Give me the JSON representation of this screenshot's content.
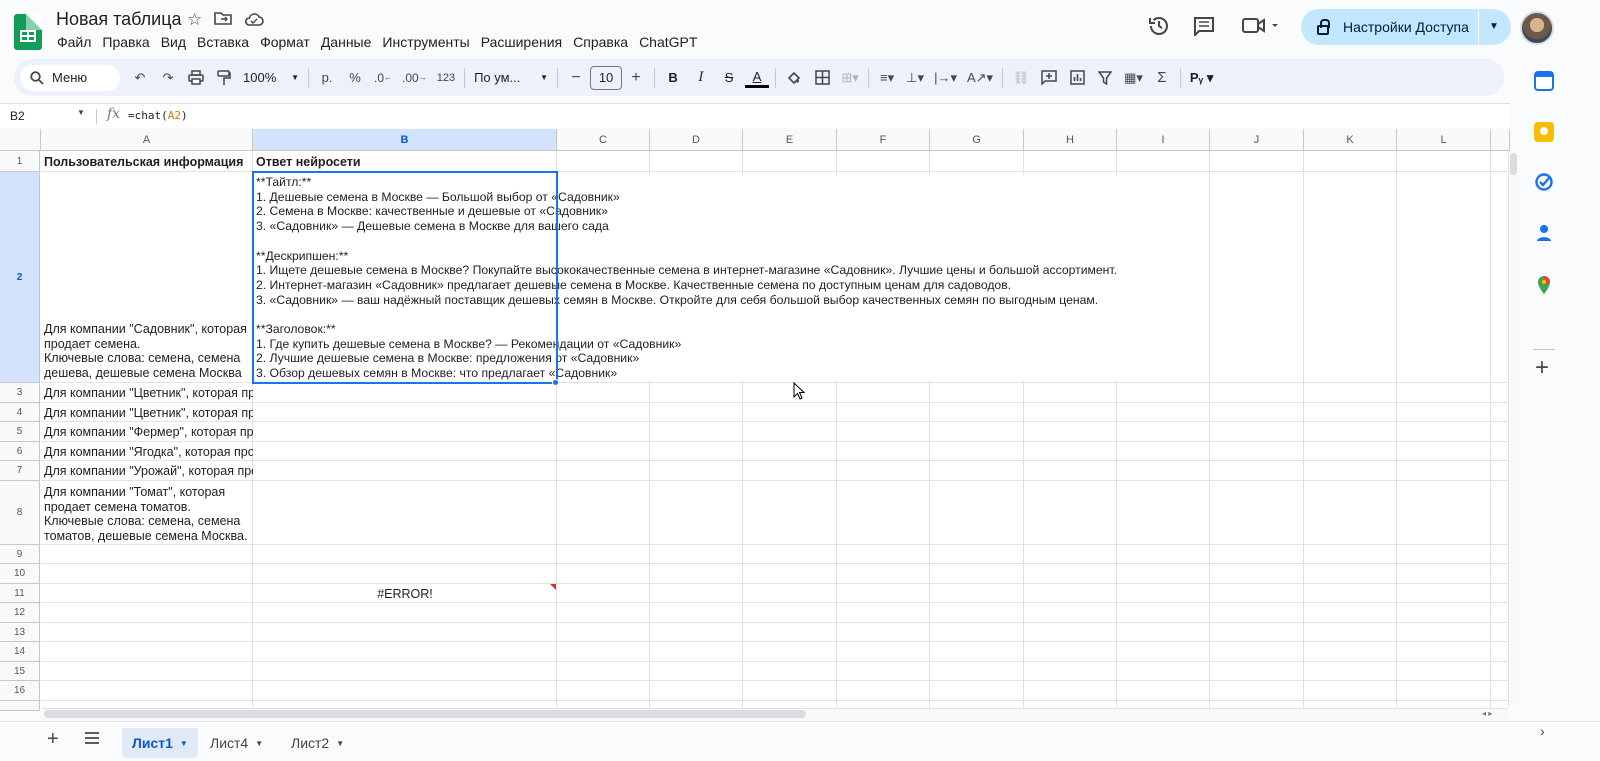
{
  "doc": {
    "title": "Новая таблица"
  },
  "menu": [
    "Файл",
    "Правка",
    "Вид",
    "Вставка",
    "Формат",
    "Данные",
    "Инструменты",
    "Расширения",
    "Справка",
    "ChatGPT"
  ],
  "share": {
    "label": "Настройки Доступа"
  },
  "toolbar": {
    "menu_label": "Меню",
    "zoom": "100%",
    "currency": "р.",
    "percent": "%",
    "dec_less": ".0",
    "dec_more": ".00",
    "number_format": "123",
    "font": "По ум...",
    "font_size": "10"
  },
  "formula_bar": {
    "cell_ref": "B2",
    "formula_prefix": "=chat(",
    "formula_ref": "A2",
    "formula_suffix": ")"
  },
  "columns": [
    "A",
    "B",
    "C",
    "D",
    "E",
    "F",
    "G",
    "H",
    "I",
    "J",
    "K",
    "L"
  ],
  "rows": [
    "1",
    "2",
    "3",
    "4",
    "5",
    "6",
    "7",
    "8",
    "9",
    "10",
    "11",
    "12",
    "13",
    "14",
    "15",
    "16"
  ],
  "cells": {
    "A1": "Пользовательская информация",
    "B1": "Ответ нейросети",
    "A2": [
      "Для компании \"Садовник\", которая",
      "продает семена.",
      "Ключевые слова: семена, семена",
      "дешева, дешевые семена Москва"
    ],
    "B2": [
      "**Тайтл:**",
      "1. Дешевые семена в Москве — Большой выбор от «Садовник»",
      "2. Семена в Москве: качественные и дешевые от «Садовник»",
      "3. «Садовник» — Дешевые семена в Москве для вашего сада",
      "",
      "**Дескрипшен:**",
      "1. Ищете дешевые семена в Москве? Покупайте высококачественные семена в интернет-магазине «Садовник». Лучшие цены и большой ассортимент.",
      "2. Интернет-магазин «Садовник» предлагает дешевые семена в Москве. Качественные семена по доступным ценам для садоводов.",
      "3. «Садовник» — ваш надёжный поставщик дешевых семян в Москве. Откройте для себя большой выбор качественных семян по выгодным ценам.",
      "",
      "**Заголовок:**",
      "1. Где купить дешевые семена в Москве? — Рекомендации от «Садовник»",
      "2. Лучшие дешевые семена в Москве: предложения от «Садовник»",
      "3. Обзор дешевых семян в Москве: что предлагает «Садовник»"
    ],
    "A3": "Для компании \"Цветник\", которая про",
    "A4": "Для компании \"Цветник\", которая про",
    "A5": "Для компании \"Фермер\", которая про",
    "A6": "Для компании \"Ягодка\", которая прод",
    "A7": "Для компании \"Урожай\", которая про",
    "A8": [
      "Для компании \"Томат\", которая",
      "продает семена томатов.",
      "Ключевые слова: семена, семена",
      "томатов, дешевые семена Москва."
    ],
    "B11": "#ERROR!"
  },
  "sheets": [
    "Лист1",
    "Лист4",
    "Лист2"
  ],
  "active_sheet": "Лист1",
  "icons": {
    "star": "star-icon",
    "move": "move-to-folder-icon",
    "cloud": "cloud-status-icon",
    "history": "history-icon",
    "comments": "comments-icon",
    "meet": "meet-icon"
  }
}
